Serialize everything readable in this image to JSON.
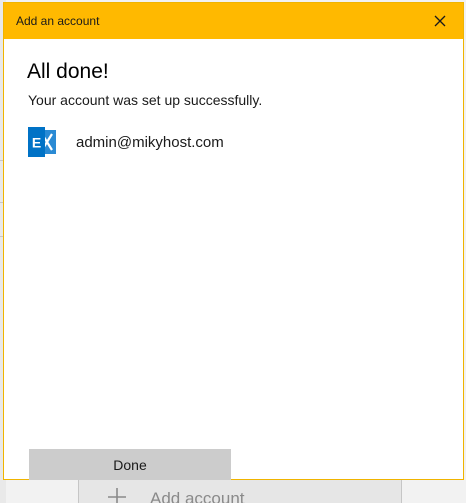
{
  "dialog": {
    "title": "Add an account",
    "heading": "All done!",
    "message": "Your account was set up successfully.",
    "account": {
      "email": "admin@mikyhost.com",
      "icon": "exchange-icon"
    },
    "done_label": "Done",
    "close_icon": "close-icon"
  },
  "background": {
    "add_account_label": "Add account",
    "add_icon": "plus-icon"
  },
  "colors": {
    "titlebar": "#ffb900",
    "exchange_blue": "#0072c6",
    "done_button": "#cccccc"
  }
}
